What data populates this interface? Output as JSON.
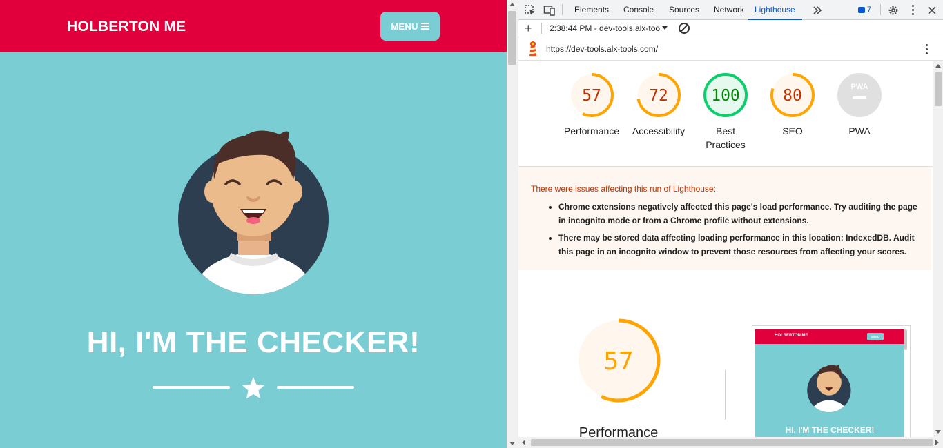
{
  "site": {
    "brand": "HOLBERTON ME",
    "menu_label": "MENU",
    "headline": "HI, I'M THE CHECKER!",
    "colors": {
      "nav": "#e1003c",
      "background": "#7acdd2",
      "text": "#ffffff"
    }
  },
  "devtools": {
    "tabs": [
      {
        "label": "Elements",
        "active": false
      },
      {
        "label": "Console",
        "active": false
      },
      {
        "label": "Sources",
        "active": false
      },
      {
        "label": "Network",
        "active": false
      },
      {
        "label": "Lighthouse",
        "active": true
      }
    ],
    "more_tabs_icon": "double-chevron-icon",
    "issues_count": "7",
    "report_selector": "2:38:44 PM - dev-tools.alx-too",
    "url": "https://dev-tools.alx-tools.com/",
    "scores": [
      {
        "label": "Performance",
        "value": 57,
        "color": "#ffa400",
        "text_color": "#c33300",
        "bg": "#fff6ed"
      },
      {
        "label": "Accessibility",
        "value": 72,
        "color": "#ffa400",
        "text_color": "#c33300",
        "bg": "#fff6ed"
      },
      {
        "label": "Best Practices",
        "value": 100,
        "color": "#0cce6b",
        "text_color": "#008800",
        "bg": "#e6f9ef"
      },
      {
        "label": "SEO",
        "value": 80,
        "color": "#ffa400",
        "text_color": "#c33300",
        "bg": "#fff6ed"
      },
      {
        "label": "PWA",
        "value": null,
        "badge_text": "PWA"
      }
    ],
    "warning": {
      "title": "There were issues affecting this run of Lighthouse:",
      "items": [
        "Chrome extensions negatively affected this page's load performance. Try auditing the page in incognito mode or from a Chrome profile without extensions.",
        "There may be stored data affecting loading performance in this location: IndexedDB. Audit this page in an incognito window to prevent those resources from affecting your scores."
      ]
    },
    "performance_detail": {
      "label": "Performance",
      "value": 57
    },
    "screenshot": {
      "brand": "HOLBERTON ME",
      "menu_label": "MENU",
      "headline": "HI, I'M THE CHECKER!"
    }
  }
}
